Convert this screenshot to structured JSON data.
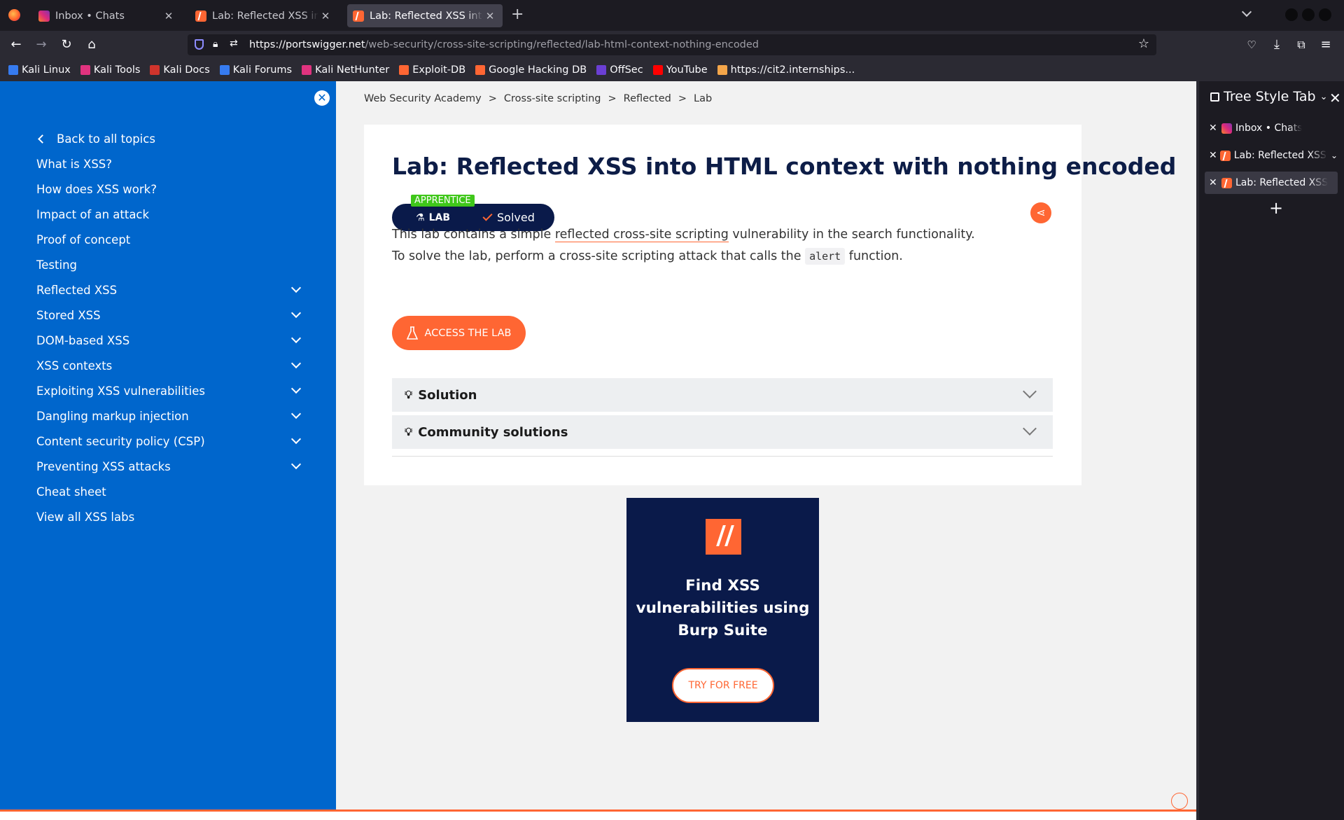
{
  "browser": {
    "tabs": [
      {
        "title": "Inbox • Chats",
        "icon": "instagram-icon",
        "active": false
      },
      {
        "title": "Lab: Reflected XSS into HTML context",
        "icon": "portswigger-icon",
        "active": false
      },
      {
        "title": "Lab: Reflected XSS into HTML context",
        "icon": "portswigger-icon",
        "active": true
      }
    ],
    "new_tab": "+",
    "url_host": "https://portswigger.net",
    "url_path": "/web-security/cross-site-scripting/reflected/lab-html-context-nothing-encoded",
    "bookmarks": [
      {
        "label": "Kali Linux",
        "color": "#367bf0"
      },
      {
        "label": "Kali Tools",
        "color": "#e0337f"
      },
      {
        "label": "Kali Docs",
        "color": "#d0342c"
      },
      {
        "label": "Kali Forums",
        "color": "#367bf0"
      },
      {
        "label": "Kali NetHunter",
        "color": "#e0337f"
      },
      {
        "label": "Exploit-DB",
        "color": "#ff6633"
      },
      {
        "label": "Google Hacking DB",
        "color": "#ff6633"
      },
      {
        "label": "OffSec",
        "color": "#6b3fd4"
      },
      {
        "label": "YouTube",
        "color": "#ff0000"
      },
      {
        "label": "https://cit2.internships...",
        "color": "#f4a64a"
      }
    ]
  },
  "sidebar": {
    "back": "Back to all topics",
    "items": [
      {
        "label": "What is XSS?",
        "expandable": false
      },
      {
        "label": "How does XSS work?",
        "expandable": false
      },
      {
        "label": "Impact of an attack",
        "expandable": false
      },
      {
        "label": "Proof of concept",
        "expandable": false
      },
      {
        "label": "Testing",
        "expandable": false
      },
      {
        "label": "Reflected XSS",
        "expandable": true
      },
      {
        "label": "Stored XSS",
        "expandable": true
      },
      {
        "label": "DOM-based XSS",
        "expandable": true
      },
      {
        "label": "XSS contexts",
        "expandable": true
      },
      {
        "label": "Exploiting XSS vulnerabilities",
        "expandable": true
      },
      {
        "label": "Dangling markup injection",
        "expandable": true
      },
      {
        "label": "Content security policy (CSP)",
        "expandable": true
      },
      {
        "label": "Preventing XSS attacks",
        "expandable": true
      },
      {
        "label": "Cheat sheet",
        "expandable": false
      },
      {
        "label": "View all XSS labs",
        "expandable": false
      }
    ]
  },
  "breadcrumb": [
    "Web Security Academy",
    "Cross-site scripting",
    "Reflected",
    "Lab"
  ],
  "breadcrumb_sep": ">",
  "lab": {
    "title": "Lab: Reflected XSS into HTML context with nothing encoded",
    "level": "APPRENTICE",
    "badge_lab": "LAB",
    "badge_status": "Solved",
    "desc1_pre": "This lab contains a simple ",
    "desc1_link": "reflected cross-site scripting",
    "desc1_post": " vulnerability in the search functionality.",
    "desc2_pre": "To solve the lab, perform a cross-site scripting attack that calls the ",
    "desc2_code": "alert",
    "desc2_post": " function.",
    "access_button": "ACCESS THE LAB",
    "solution": "Solution",
    "community": "Community solutions"
  },
  "ad": {
    "text": "Find XSS vulnerabilities using Burp Suite",
    "button": "TRY FOR FREE"
  },
  "tst": {
    "title": "Tree Style Tab",
    "rows": [
      {
        "title": "Inbox • Chats",
        "icon": "instagram-icon"
      },
      {
        "title": "Lab: Reflected XSS into",
        "icon": "portswigger-icon"
      },
      {
        "title": "Lab: Reflected XSS",
        "icon": "portswigger-icon"
      }
    ],
    "add": "+"
  }
}
